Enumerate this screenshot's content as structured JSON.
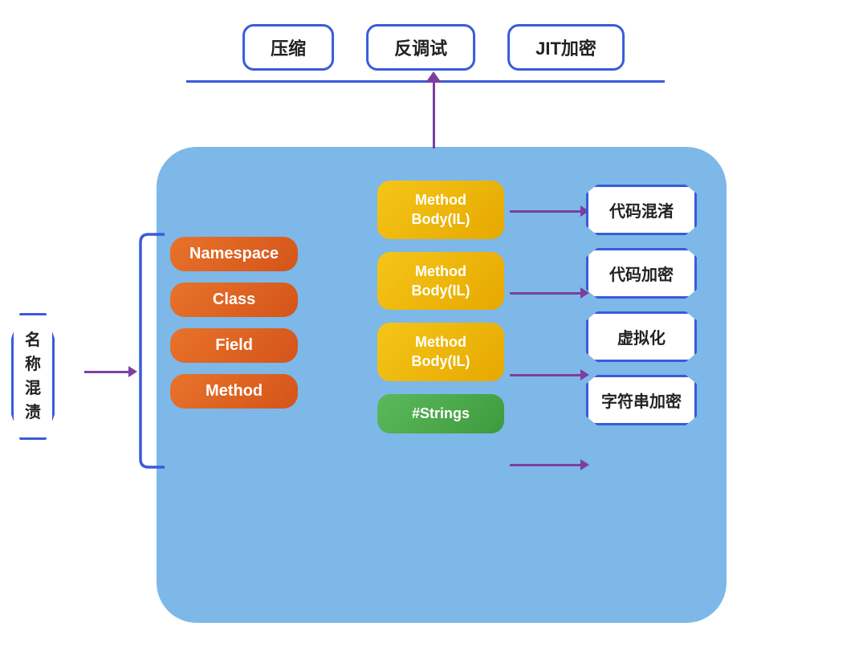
{
  "top_badges": [
    "压缩",
    "反调试",
    "JIT加密"
  ],
  "left_name_badge": "名\n称\n混\n渍",
  "left_name_badge_lines": [
    "名",
    "称",
    "混",
    "渍"
  ],
  "orange_items": [
    "Namespace",
    "Class",
    "Field",
    "Method"
  ],
  "yellow_items": [
    "Method\nBody(IL)",
    "Method\nBody(IL)",
    "Method\nBody(IL)"
  ],
  "yellow_line1": "Method",
  "yellow_line2": "Body(IL)",
  "green_item": "#Strings",
  "right_labels": [
    "代码混渚",
    "代码加密",
    "虚拟化",
    "字符串加密"
  ],
  "right_label_0": "代码混渚",
  "right_label_1": "代码加密",
  "right_label_2": "虚拟化",
  "right_label_3": "字符串加密",
  "colors": {
    "blue_border": "#3a5bd9",
    "blue_bg": "#7db8e8",
    "orange": "#e8732a",
    "yellow": "#f5c518",
    "green": "#5cb85c",
    "purple": "#7c3fa0",
    "white": "#ffffff"
  }
}
